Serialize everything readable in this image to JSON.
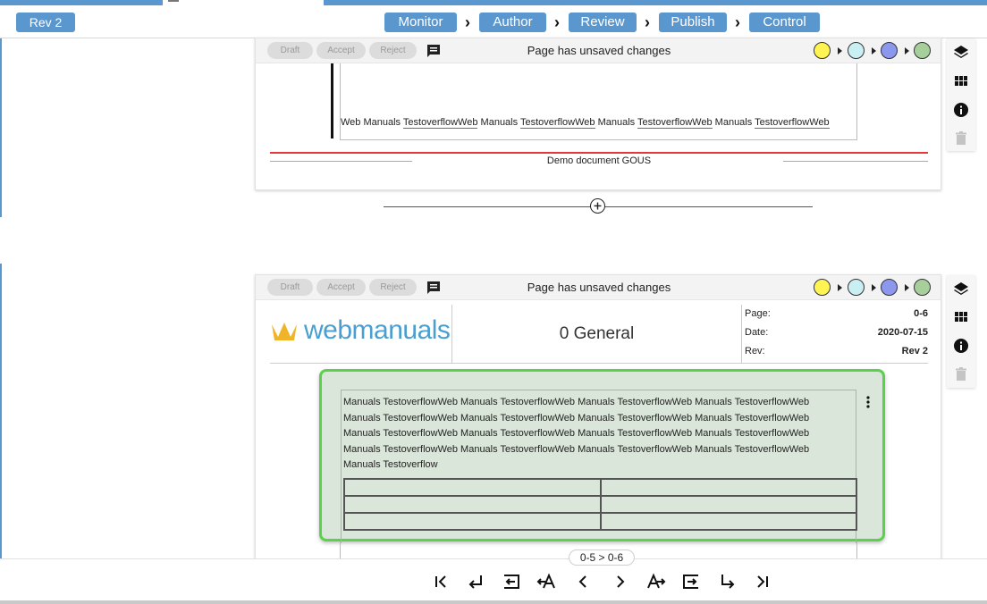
{
  "header": {
    "rev_label": "Rev 2",
    "stages": [
      "Monitor",
      "Author",
      "Review",
      "Publish",
      "Control"
    ]
  },
  "toolbar": {
    "draft": "Draft",
    "accept": "Accept",
    "reject": "Reject",
    "status": "Page has unsaved changes",
    "status_dots": [
      "#fff451",
      "#c9eff3",
      "#8c97ee",
      "#a6cf9c"
    ]
  },
  "page1": {
    "body_text": "Web Manuals TestoverflowWeb Manuals TestoverflowWeb Manuals TestoverflowWeb Manuals TestoverflowWeb",
    "footer": "Demo document GOUS"
  },
  "page2": {
    "logo": "webmanuals",
    "section_title": "0 General",
    "meta": [
      {
        "label": "Page:",
        "value": "0-6"
      },
      {
        "label": "Date:",
        "value": "2020-07-15"
      },
      {
        "label": "Rev:",
        "value": "Rev 2"
      }
    ],
    "block_text": "Manuals TestoverflowWeb Manuals TestoverflowWeb Manuals TestoverflowWeb Manuals TestoverflowWeb Manuals TestoverflowWeb Manuals TestoverflowWeb Manuals TestoverflowWeb Manuals TestoverflowWeb Manuals TestoverflowWeb Manuals TestoverflowWeb Manuals TestoverflowWeb Manuals TestoverflowWeb Manuals TestoverflowWeb Manuals TestoverflowWeb Manuals TestoverflowWeb Manuals TestoverflowWeb Manuals Testoverflow"
  },
  "nav": {
    "breadcrumb": "0-5 > 0-6",
    "buttons": [
      "first-page",
      "return",
      "prev-section",
      "prev-change",
      "prev",
      "next",
      "next-change",
      "next-section",
      "down-right",
      "last-page"
    ]
  },
  "colors": {
    "accent": "#5b97cf",
    "highlight_border": "#5bd04c",
    "block_bg": "#d9e6d9",
    "danger_rule": "#e53935"
  }
}
